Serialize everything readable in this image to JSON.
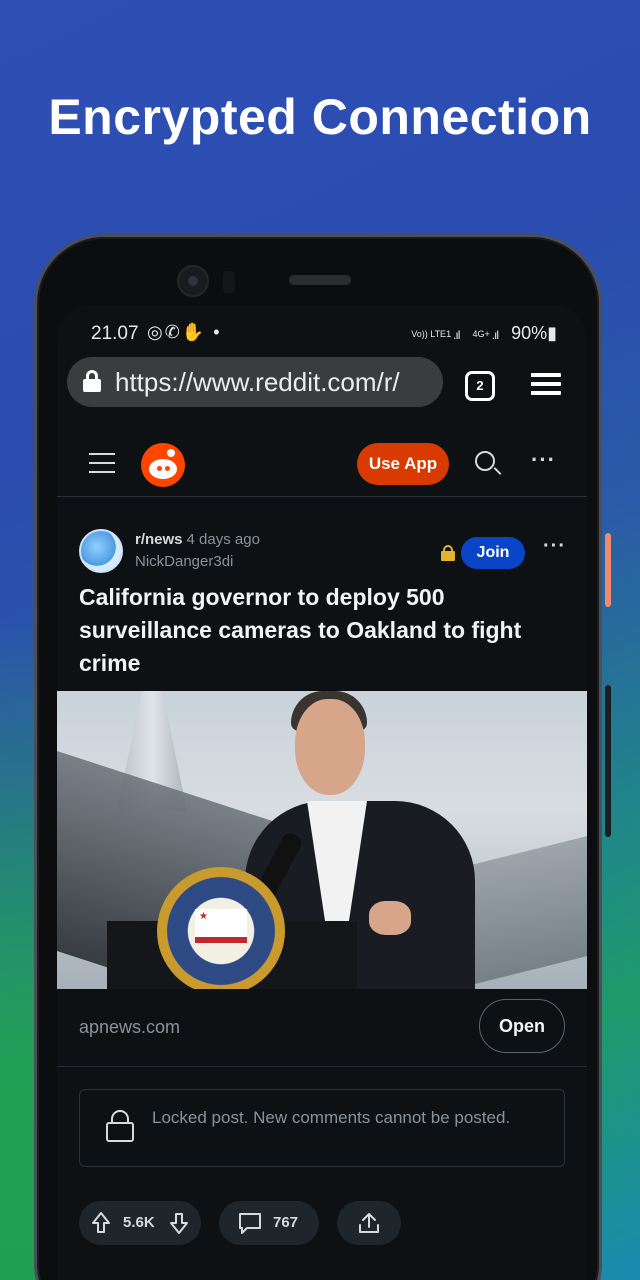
{
  "headline": "Encrypted Connection",
  "status_bar": {
    "time": "21.07",
    "battery": "90%",
    "network_label": "4G+",
    "volte_label": "Vo)) LTE1"
  },
  "browser": {
    "url": "https://www.reddit.com/r/",
    "tab_count": "2"
  },
  "reddit_nav": {
    "use_app_label": "Use App"
  },
  "post": {
    "subreddit": "r/news",
    "time_ago": "4 days ago",
    "author": "NickDanger3di",
    "join_label": "Join",
    "title": "California governor to deploy 500 surveillance cameras to Oakland to fight crime",
    "link_domain": "apnews.com",
    "open_label": "Open",
    "locked_message": "Locked post. New comments cannot be posted.",
    "vote_count": "5.6K",
    "comment_count": "767"
  },
  "colors": {
    "accent_orange": "#D93A00",
    "join_blue": "#0A45C8",
    "lock_gold": "#E5B22C",
    "screen_bg": "#0D1114"
  },
  "icons": [
    "lock-icon",
    "tabs-icon",
    "browser-menu-icon",
    "hamburger-icon",
    "reddit-logo-icon",
    "search-icon",
    "more-icon",
    "upvote-icon",
    "downvote-icon",
    "comment-icon",
    "share-icon"
  ]
}
